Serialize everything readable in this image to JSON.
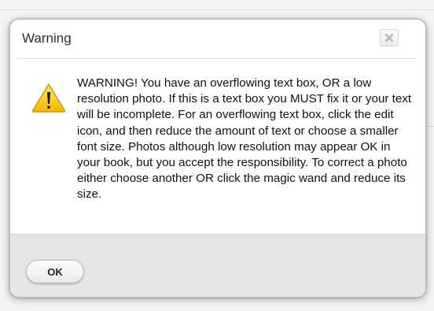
{
  "dialog": {
    "title": "Warning",
    "close_icon": "close-icon",
    "warning_icon": "warning-icon",
    "message": "WARNING! You have an overflowing text box, OR a low resolution photo. If this is a text box you MUST fix it or your text will be incomplete. For an overflowing text box, click the edit icon, and then reduce the amount of text or choose a smaller font size. Photos although low resolution may appear OK in your book, but you accept the responsibility. To correct a photo either choose another OR click the magic wand and reduce its size.",
    "ok_label": "OK"
  },
  "colors": {
    "warning_yellow": "#f5c800",
    "footer_gray": "#e6e6e6"
  }
}
